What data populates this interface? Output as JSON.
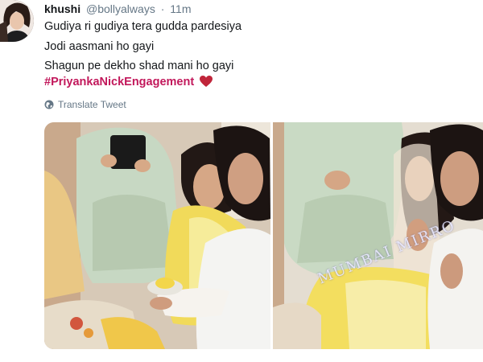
{
  "tweet": {
    "author_name": "khushi",
    "handle": "@bollyalways",
    "separator": "·",
    "time": "11m",
    "lines": [
      "Gudiya ri gudiya tera gudda pardesiya",
      "Jodi aasmani ho gayi",
      "Shagun pe dekho shad mani ho gayi"
    ],
    "hashtag": "#PriyankaNickEngagement",
    "heart_emoji": "heart-emoji",
    "translate_label": "Translate Tweet",
    "globe_icon": "globe-icon"
  },
  "media": {
    "watermark": "MUMBAI MIRRO"
  },
  "colors": {
    "text": "#14171a",
    "muted": "#657786",
    "hashtag": "#c2185b",
    "heart": "#c0253a"
  }
}
